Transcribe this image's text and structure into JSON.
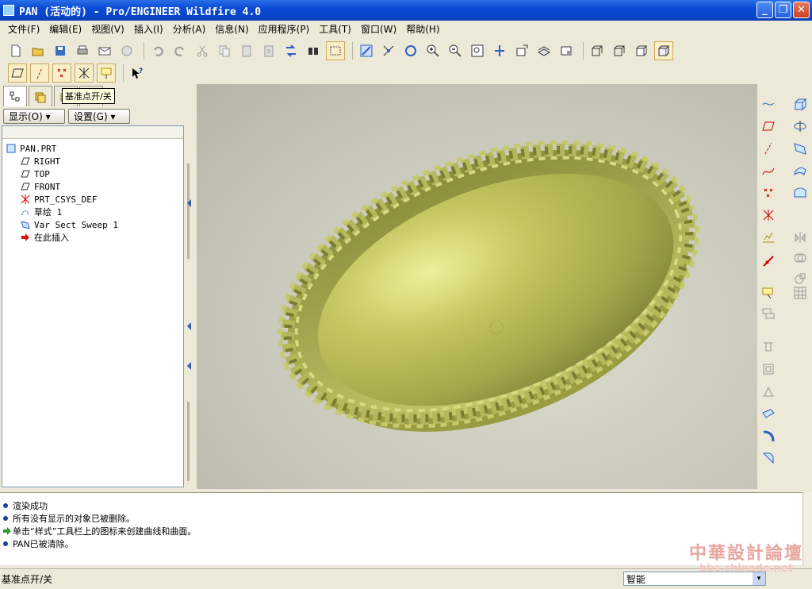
{
  "window": {
    "title": "PAN (活动的) - Pro/ENGINEER Wildfire 4.0",
    "minimize": "_",
    "maximize": "❐",
    "close": "✕"
  },
  "menu": [
    "文件(F)",
    "编辑(E)",
    "视图(V)",
    "插入(I)",
    "分析(A)",
    "信息(N)",
    "应用程序(P)",
    "工具(T)",
    "窗口(W)",
    "帮助(H)"
  ],
  "tooltip": "基准点开/关",
  "panel": {
    "show_button": "显示(O) ▾",
    "settings_button": "设置(G) ▾"
  },
  "model_tree": [
    {
      "label": "PAN.PRT",
      "icon": "part-icon"
    },
    {
      "label": "RIGHT",
      "icon": "datum-plane-icon"
    },
    {
      "label": "TOP",
      "icon": "datum-plane-icon"
    },
    {
      "label": "FRONT",
      "icon": "datum-plane-icon"
    },
    {
      "label": "PRT_CSYS_DEF",
      "icon": "csys-icon"
    },
    {
      "label": "草绘 1",
      "icon": "sketch-icon"
    },
    {
      "label": "Var Sect Sweep 1",
      "icon": "sweep-icon"
    },
    {
      "label": "在此插入",
      "icon": "insert-here-arrow-icon"
    }
  ],
  "messages": [
    {
      "text": "渲染成功",
      "type": "info"
    },
    {
      "text": "所有没有显示的对象已被删除。",
      "type": "info"
    },
    {
      "text": "单击“样式”工具栏上的图标来创建曲线和曲面。",
      "type": "prompt"
    },
    {
      "text": "PAN已被清除。",
      "type": "info"
    }
  ],
  "status": {
    "text": "基准点开/关",
    "filter": "智能",
    "filter_arrow": "▾"
  },
  "watermark": {
    "title": "中華設計論壇",
    "url": "bbs.chinade.net"
  },
  "colors": {
    "model_olive": "#a8ad4f",
    "highlight": "#f0f2b0",
    "titlebar": "#0a4bd6"
  }
}
